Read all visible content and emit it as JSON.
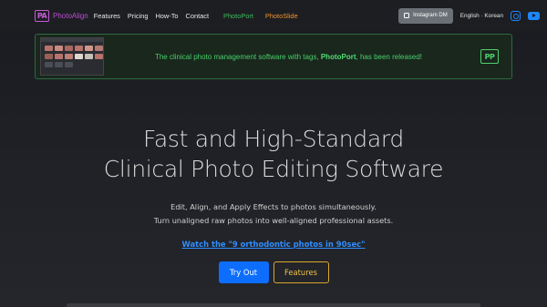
{
  "navbar": {
    "brand_logo": "PA",
    "brand_name": "PhotoAlign",
    "links": [
      "Features",
      "Pricing",
      "How-To",
      "Contact"
    ],
    "photoport": "PhotoPort",
    "photoslide": "PhotoSlide",
    "instagram_dm": "Instagram DM",
    "language": "English · Korean",
    "icons": [
      "instagram-icon",
      "youtube-icon"
    ],
    "colors": {
      "brand": "#c35ad6",
      "photoport": "#3cbf5e",
      "photoslide": "#f0922b",
      "social": "#1e86ff"
    }
  },
  "banner": {
    "text_before": "The clinical photo management software with tags, ",
    "text_bold": "PhotoPort",
    "text_after": ", has been released!",
    "logo": "PP"
  },
  "hero": {
    "title_line1": "Fast and High-Standard",
    "title_line2": "Clinical Photo Editing Software",
    "subtitle_line1": "Edit, Align, and Apply Effects to photos simultaneously.",
    "subtitle_line2": "Turn unaligned raw photos into well-aligned professional assets.",
    "video_link": "Watch the \"9 orthodontic photos in 90sec\"",
    "try_out": "Try Out",
    "features": "Features"
  }
}
